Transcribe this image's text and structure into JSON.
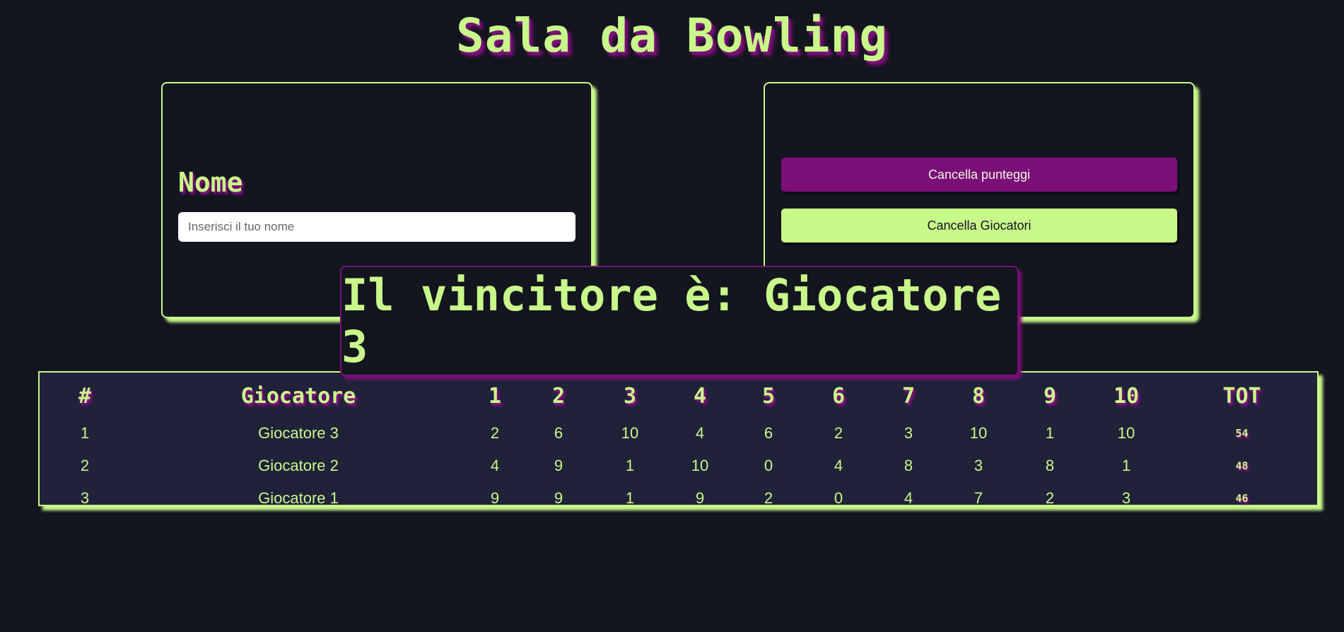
{
  "title": "Sala da Bowling",
  "name_section": {
    "label": "Nome",
    "input_value": "",
    "input_placeholder": "Inserisci il tuo nome"
  },
  "actions": {
    "clear_scores_label": "Cancella punteggi",
    "clear_players_label": "Cancella Giocatori"
  },
  "winner_banner": "Il vincitore è: Giocatore 3",
  "colors": {
    "background": "#13151f",
    "accent_green": "#c9f88a",
    "accent_purple": "#7a0f78",
    "table_background": "#20223a"
  },
  "scoreboard": {
    "headers": [
      "#",
      "Giocatore",
      "1",
      "2",
      "3",
      "4",
      "5",
      "6",
      "7",
      "8",
      "9",
      "10",
      "TOT"
    ],
    "rows": [
      {
        "rank": "1",
        "player": "Giocatore 3",
        "frames": [
          "2",
          "6",
          "10",
          "4",
          "6",
          "2",
          "3",
          "10",
          "1",
          "10"
        ],
        "total": "54"
      },
      {
        "rank": "2",
        "player": "Giocatore 2",
        "frames": [
          "4",
          "9",
          "1",
          "10",
          "0",
          "4",
          "8",
          "3",
          "8",
          "1"
        ],
        "total": "48"
      },
      {
        "rank": "3",
        "player": "Giocatore 1",
        "frames": [
          "9",
          "9",
          "1",
          "9",
          "2",
          "0",
          "4",
          "7",
          "2",
          "3"
        ],
        "total": "46"
      }
    ]
  }
}
